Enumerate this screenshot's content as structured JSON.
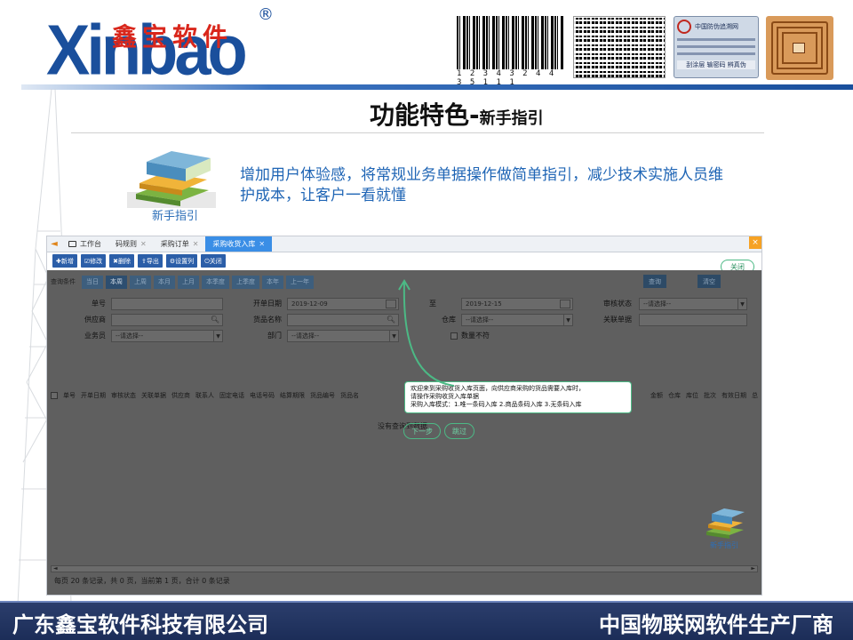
{
  "brand": {
    "logo_latin": "Xinbao",
    "logo_chinese": "鑫宝软件",
    "registered_mark": "®",
    "barcode_number": "1 2 3 4 3 2 4 4 3 5 1 1 1",
    "colors": {
      "blue": "#1a4f9c",
      "red": "#d9271c"
    }
  },
  "antifake_label": {
    "header": "中国防伪追溯网",
    "footer": "刮涂层 输密码 辨真伪"
  },
  "slide": {
    "title_main": "功能特色",
    "title_sub": "新手指引",
    "book_label": "新手指引",
    "intro": "增加用户体验感，将常规业务单据操作做简单指引，减少技术实施人员维护成本，让客户一看就懂"
  },
  "app": {
    "tabs": [
      {
        "label": "工作台",
        "active": false,
        "icon": "monitor-icon"
      },
      {
        "label": "码规则",
        "active": false
      },
      {
        "label": "采购订单",
        "active": false
      },
      {
        "label": "采购收货入库",
        "active": true
      }
    ],
    "close_all_glyph": "×",
    "toolbar": [
      {
        "label": "✚新增"
      },
      {
        "label": "☑修改"
      },
      {
        "label": "✖删除"
      },
      {
        "label": "⇪导出"
      },
      {
        "label": "⚙设置列"
      },
      {
        "label": "⏻关闭"
      }
    ],
    "close_pill": "关闭",
    "query": {
      "label": "查询条件",
      "ranges": [
        "当日",
        "本周",
        "上周",
        "本月",
        "上月",
        "本季度",
        "上季度",
        "本年",
        "上一年"
      ],
      "active_range": "本周",
      "search_button": "查询",
      "clear_button": "清空"
    },
    "fields": {
      "order_no": "单号",
      "supplier": "供应商",
      "salesman": "业务员",
      "salesman_placeholder": "--请选择--",
      "date_from_label": "开单日期",
      "date_from": "2019-12-09",
      "goods_name": "货品名称",
      "dept": "部门",
      "dept_placeholder": "--请选择--",
      "date_to_label": "至",
      "date_to": "2019-12-15",
      "warehouse": "仓库",
      "warehouse_placeholder": "--请选择--",
      "qty_mismatch": "数量不符",
      "audit_status": "审核状态",
      "audit_placeholder": "--请选择--",
      "linked_doc": "关联单据"
    },
    "columns": [
      "单号",
      "开单日期",
      "审核状态",
      "关联单据",
      "供应商",
      "联系人",
      "固定电话",
      "电话号码",
      "结算期限",
      "货品编号",
      "货品名"
    ],
    "columns_right": [
      "金额",
      "仓库",
      "库位",
      "批次",
      "有效日期",
      "总"
    ],
    "no_data": "没有查询到数据",
    "tooltip": {
      "line1": "欢迎来到采购收货入库页面，向供应商采购的货品需要入库时，",
      "line2": "请操作采购收货入库单据",
      "line3": "采购入库模式：1.唯一条码入库 2.商品条码入库 3.无条码入库"
    },
    "next_button": "下一步",
    "skip_button": "跳过",
    "pager": "每页 20 条记录，共 0 页，当前第 1 页，合计 0 条记录",
    "corner_label": "新手指引"
  },
  "footer": {
    "company": "广东鑫宝软件科技有限公司",
    "slogan": "中国物联网软件生产厂商"
  }
}
